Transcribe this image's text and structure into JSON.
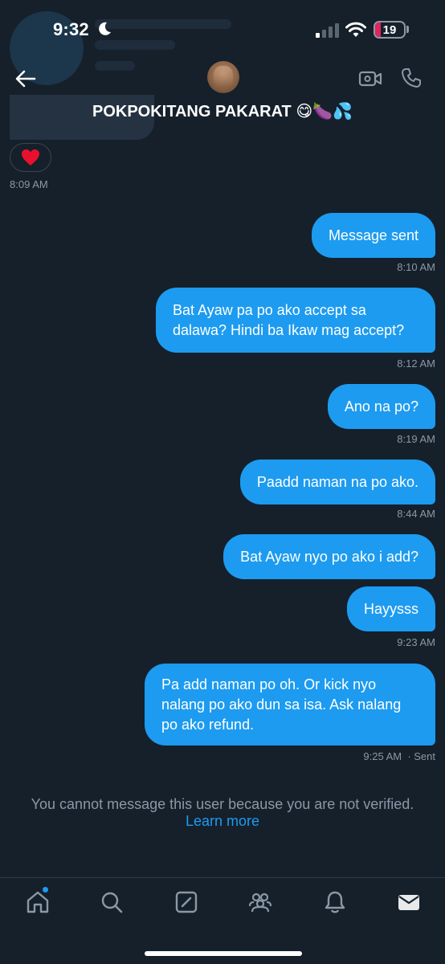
{
  "status_bar": {
    "time": "9:32",
    "battery": "19",
    "battery_level": 0.19
  },
  "header": {
    "title": "POKPOKITANG PAKARAT",
    "title_emoji": "😋🍆💦"
  },
  "earlier": {
    "reaction": "❤️",
    "time": "8:09 AM"
  },
  "messages": [
    {
      "text": "Message sent",
      "time": "8:10 AM"
    },
    {
      "text": "Bat Ayaw pa po ako accept sa dalawa? Hindi ba Ikaw mag accept?",
      "time": "8:12 AM"
    },
    {
      "text": "Ano na po?",
      "time": "8:19 AM"
    },
    {
      "text": "Paadd naman na po ako.",
      "time": "8:44 AM"
    },
    {
      "text": "Bat Ayaw nyo po ako i add?",
      "time": ""
    },
    {
      "text": "Hayysss",
      "time": "9:23 AM"
    },
    {
      "text": "Pa add naman po oh. Or kick nyo nalang po ako dun sa isa. Ask nalang po ako refund.",
      "time": "9:25 AM",
      "status": "· Sent"
    }
  ],
  "notice": {
    "text": "You cannot message this user because you are not verified.",
    "link": "Learn more"
  },
  "colors": {
    "background": "#15202b",
    "bubble": "#1d9bf0",
    "muted": "#8b98a5",
    "accent": "#1d9bf0"
  },
  "nav": {
    "items": [
      {
        "icon": "home-icon"
      },
      {
        "icon": "search-icon"
      },
      {
        "icon": "compose-icon"
      },
      {
        "icon": "communities-icon"
      },
      {
        "icon": "bell-icon"
      },
      {
        "icon": "mail-icon"
      }
    ]
  }
}
